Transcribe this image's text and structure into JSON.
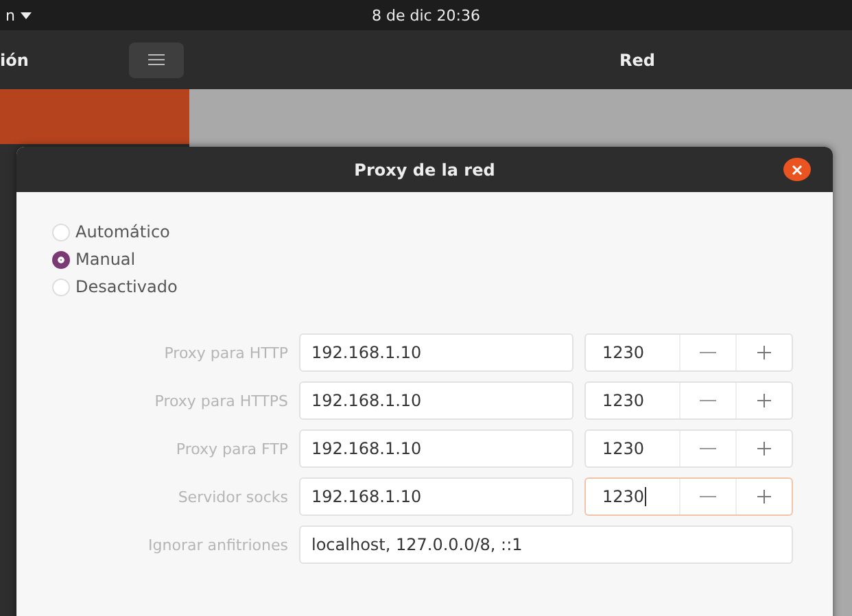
{
  "top_bar": {
    "menu": "n",
    "clock": "8 de dic  20:36"
  },
  "header": {
    "left_title": "ión",
    "title": "Red"
  },
  "dialog": {
    "title": "Proxy de la red",
    "modes": [
      {
        "label": "Automático",
        "selected": false
      },
      {
        "label": "Manual",
        "selected": true
      },
      {
        "label": "Desactivado",
        "selected": false
      }
    ],
    "proxies": [
      {
        "label": "Proxy para HTTP",
        "host": "192.168.1.10",
        "port": "1230",
        "focused": false
      },
      {
        "label": "Proxy para HTTPS",
        "host": "192.168.1.10",
        "port": "1230",
        "focused": false
      },
      {
        "label": "Proxy para FTP",
        "host": "192.168.1.10",
        "port": "1230",
        "focused": false
      },
      {
        "label": "Servidor socks",
        "host": "192.168.1.10",
        "port": "1230",
        "focused": true
      }
    ],
    "ignore": {
      "label": "Ignorar anfitriones",
      "value": "localhost, 127.0.0.0/8, ::1"
    }
  }
}
